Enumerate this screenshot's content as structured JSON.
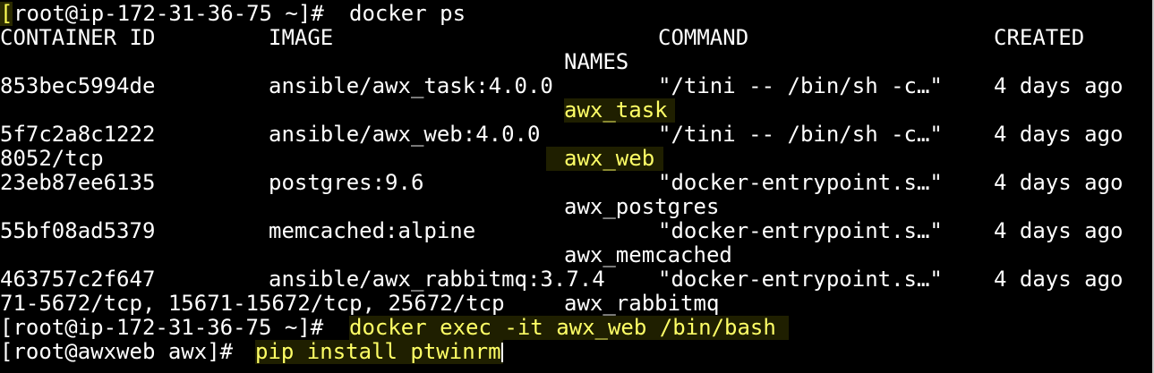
{
  "window": {
    "background": "#000000",
    "text_color": "#ffffff",
    "highlight_color": "#ffff55"
  },
  "prompt1": {
    "bracket_open": "[",
    "text": "root@ip-172-31-36-75 ~]# ",
    "command": "docker ps"
  },
  "header": {
    "container_id": "CONTAINER ID",
    "image": "IMAGE",
    "command": "COMMAND",
    "created": "CREATED",
    "names": "NAMES"
  },
  "rows": [
    {
      "id": "853bec5994de",
      "image": "ansible/awx_task:4.0.0",
      "command": "\"/tini -- /bin/sh -c…\"",
      "created": "4 days ago",
      "wrap_left": "",
      "name": "awx_task"
    },
    {
      "id": "5f7c2a8c1222",
      "image": "ansible/awx_web:4.0.0",
      "command": "\"/tini -- /bin/sh -c…\"",
      "created": "4 days ago",
      "wrap_left": "8052/tcp",
      "name": "awx_web"
    },
    {
      "id": "23eb87ee6135",
      "image": "postgres:9.6",
      "command": "\"docker-entrypoint.s…\"",
      "created": "4 days ago",
      "wrap_left": "",
      "name": "awx_postgres"
    },
    {
      "id": "55bf08ad5379",
      "image": "memcached:alpine",
      "command": "\"docker-entrypoint.s…\"",
      "created": "4 days ago",
      "wrap_left": "",
      "name": "awx_memcached"
    },
    {
      "id": "463757c2f647",
      "image": "ansible/awx_rabbitmq:3.7.4",
      "command": "\"docker-entrypoint.s…\"",
      "created": "4 days ago",
      "wrap_left": "71-5672/tcp, 15671-15672/tcp, 25672/tcp",
      "name": "awx_rabbitmq"
    }
  ],
  "prompt2": {
    "text": "[root@ip-172-31-36-75 ~]# ",
    "command": "docker exec -it awx_web /bin/bash"
  },
  "prompt3": {
    "text": "[root@awxweb awx]# ",
    "command": "pip install ptwinrm"
  }
}
